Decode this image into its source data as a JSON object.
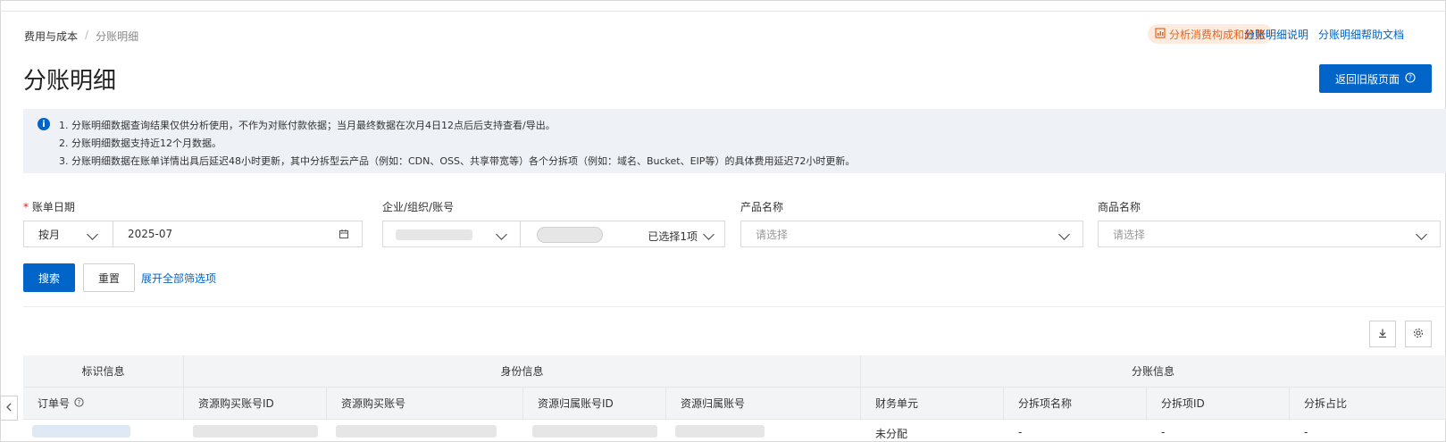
{
  "breadcrumb": {
    "parent": "费用与成本",
    "separator": "/",
    "current": "分账明细"
  },
  "top_links": {
    "analysis": "分析消费构成和趋势",
    "explain": "分账明细说明",
    "help": "分账明细帮助文档"
  },
  "page_title": "分账明细",
  "back_button": "返回旧版页面",
  "notice": {
    "lines": [
      "1. 分账明细数据查询结果仅供分析使用，不作为对账付款依据；当月最终数据在次月4日12点后后支持查看/导出。",
      "2. 分账明细数据支持近12个月数据。",
      "3. 分账明细数据在账单详情出具后延迟48小时更新，其中分拆型云产品（例如：CDN、OSS、共享带宽等）各个分拆项（例如：域名、Bucket、EIP等）的具体费用延迟72小时更新。"
    ]
  },
  "filters": {
    "bill_date": {
      "required_mark": "*",
      "label": "账单日期",
      "mode": "按月",
      "value": "2025-07"
    },
    "account": {
      "label": "企业/组织/账号",
      "selected": "已选择1项"
    },
    "product": {
      "label": "产品名称",
      "placeholder": "请选择"
    },
    "commodity": {
      "label": "商品名称",
      "placeholder": "请选择"
    }
  },
  "actions": {
    "search": "搜索",
    "reset": "重置",
    "expand": "展开全部筛选项"
  },
  "table": {
    "groups": [
      "标识信息",
      "身份信息",
      "分账信息"
    ],
    "columns": [
      "订单号",
      "资源购买账号ID",
      "资源购买账号",
      "资源归属账号ID",
      "资源归属账号",
      "财务单元",
      "分拆项名称",
      "分拆项ID",
      "分拆占比"
    ],
    "row": {
      "finance_unit": "未分配",
      "split_name": "-",
      "split_id": "-",
      "split_ratio": "-"
    }
  },
  "colors": {
    "primary": "#0064c8",
    "accent": "#e8651d",
    "notice_bg": "#eef1f6"
  }
}
